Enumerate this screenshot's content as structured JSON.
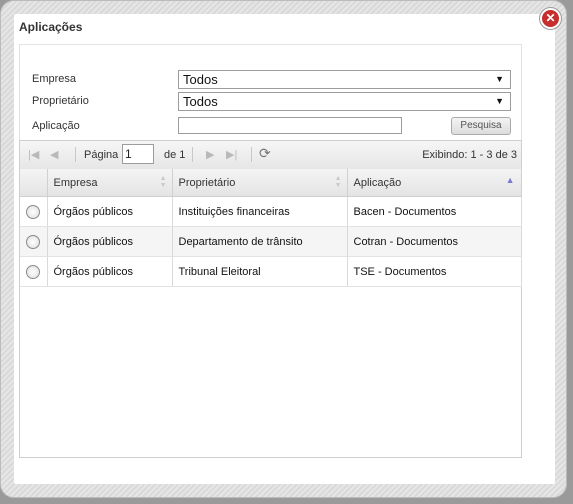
{
  "dialog": {
    "title": "Aplicações",
    "close_glyph": "✕"
  },
  "filters": {
    "empresa_label": "Empresa",
    "empresa_value": "Todos",
    "proprietario_label": "Proprietário",
    "proprietario_value": "Todos",
    "aplicacao_label": "Aplicação",
    "aplicacao_value": "",
    "search_button": "Pesquisa"
  },
  "pager": {
    "page_label": "Página",
    "page_value": "1",
    "of_label": "de 1",
    "info": "Exibindo: 1 - 3 de 3"
  },
  "table": {
    "columns": [
      "Empresa",
      "Proprietário",
      "Aplicação"
    ],
    "sorted_column": "Aplicação",
    "rows": [
      [
        "Órgãos públicos",
        "Instituições financeiras",
        "Bacen - Documentos"
      ],
      [
        "Órgãos públicos",
        "Departamento de trânsito",
        "Cotran - Documentos"
      ],
      [
        "Órgãos públicos",
        "Tribunal Eleitoral",
        "TSE - Documentos"
      ]
    ]
  }
}
